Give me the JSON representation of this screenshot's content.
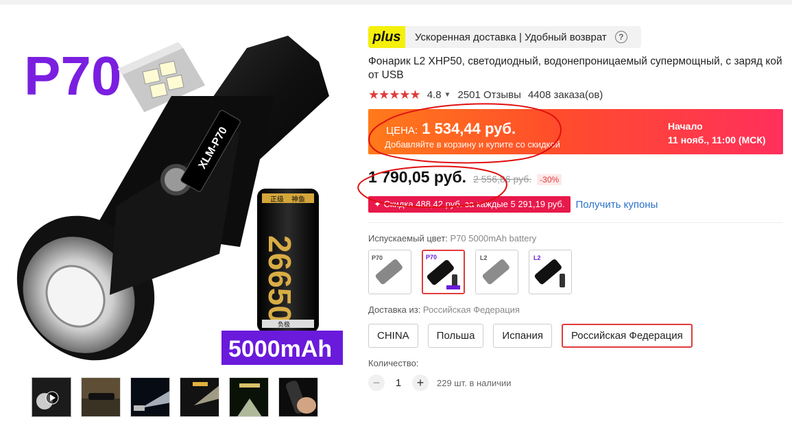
{
  "product_image": {
    "model_label": "P70",
    "body_text": "XLM-P70",
    "battery_text": "26650",
    "battery_brand": "神鱼",
    "battery_tag_top": "正级",
    "battery_tag_bottom": "负极",
    "capacity_label": "5000mAh"
  },
  "thumbnails": [
    {
      "name": "video-thumb",
      "icon": "play-icon"
    },
    {
      "name": "outdoor-thumb"
    },
    {
      "name": "night-beam-thumb"
    },
    {
      "name": "lumen-thumb"
    },
    {
      "name": "light-scene-thumb"
    },
    {
      "name": "hand-thumb"
    }
  ],
  "plus": {
    "badge": "plus",
    "text": "Ускоренная доставка | Удобный возврат",
    "help": "?"
  },
  "title": "Фонарик L2 XHP50, светодиодный, водонепроницаемый супермощный, с заряд кой от USB",
  "rating": {
    "stars": "★★★★★",
    "value": "4.8",
    "reviews": "2501 Отзывы",
    "orders": "4408 заказа(ов)"
  },
  "promo": {
    "label": "ЦЕНА:",
    "price": "1 534,44 руб.",
    "note": "Добавляйте в корзину и купите со скидкой",
    "start_label": "Начало",
    "start_date": "11 нояб., 11:00 (МСК)"
  },
  "price": {
    "current": "1 790,05 руб.",
    "old": "2 556,86 руб.",
    "discount": "-30%"
  },
  "coupon": {
    "badge": "✦ Скидка 488,42 руб. за каждые 5 291,19 руб.",
    "link": "Получить купоны"
  },
  "color": {
    "label": "Испускаемый цвет:",
    "value": "P70 5000mAh battery",
    "options": [
      "P70",
      "P70",
      "L2",
      "L2"
    ]
  },
  "shipping": {
    "label": "Доставка из:",
    "value": "Российская Федерация",
    "options": [
      "CHINA",
      "Польша",
      "Испания",
      "Российская Федерация"
    ]
  },
  "quantity": {
    "label": "Количество:",
    "minus": "−",
    "value": "1",
    "plus": "+",
    "stock": "229 шт. в наличии"
  },
  "colors": {
    "accent": "#e03b3b",
    "plus_yellow": "#f4f00a",
    "link": "#2a71c9"
  }
}
